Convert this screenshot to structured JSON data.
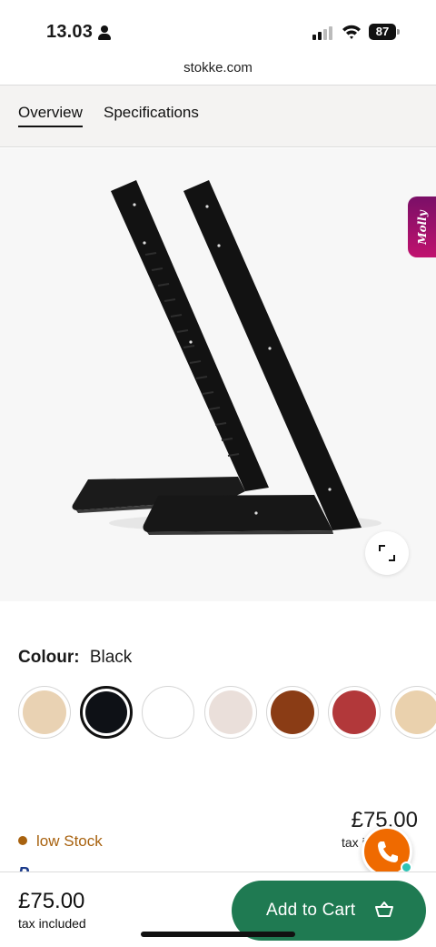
{
  "status_bar": {
    "time": "13.03",
    "battery": "87",
    "icons": [
      "person-icon",
      "signal-icon",
      "wifi-icon",
      "battery-icon"
    ]
  },
  "browser": {
    "url": "stokke.com"
  },
  "tabs": [
    {
      "label": "Overview",
      "active": true
    },
    {
      "label": "Specifications",
      "active": false
    }
  ],
  "product_image": {
    "subject": "black chair side panels",
    "zoom_icon": "expand-icon"
  },
  "molly_tab": {
    "label": "Molly"
  },
  "colour": {
    "label": "Colour:",
    "selected": "Black",
    "swatches": [
      {
        "color": "#e9d2b3",
        "selected": false
      },
      {
        "color": "#0e1116",
        "selected": true
      },
      {
        "color": "#ffffff",
        "selected": false
      },
      {
        "color": "#eadfda",
        "selected": false
      },
      {
        "color": "#8a3c15",
        "selected": false
      },
      {
        "color": "#b2383a",
        "selected": false
      },
      {
        "color": "#ead1ad",
        "selected": false
      }
    ]
  },
  "price": {
    "amount": "£75.00",
    "tax_note": "tax included"
  },
  "stock": {
    "label": "low Stock",
    "color": "#a8620f"
  },
  "call_button": {
    "icon": "phone-icon",
    "color": "#ef6a00",
    "status_color": "#2ec4b6"
  },
  "bottom_bar": {
    "price": "£75.00",
    "tax_note": "tax included",
    "cart_label": "Add to Cart",
    "cart_icon": "basket-icon",
    "cart_color": "#1f7a52"
  }
}
